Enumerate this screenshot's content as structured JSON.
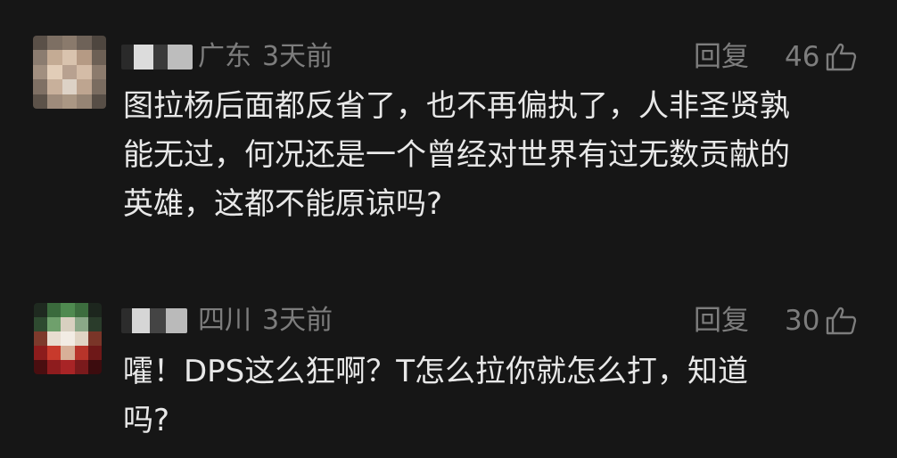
{
  "comments": [
    {
      "region": "广东",
      "time": "3天前",
      "reply_label": "回复",
      "likes": "46",
      "like_icon": "thumbs-up-icon",
      "body_lines": [
        "图拉杨后面都反省了，也不再偏执了，人非圣贤孰",
        "能无过，何况还是一个曾经对世界有过无数贡献的",
        "英雄，这都不能原谅吗?"
      ]
    },
    {
      "region": "四川",
      "time": "3天前",
      "reply_label": "回复",
      "likes": "30",
      "like_icon": "thumbs-up-icon",
      "body_lines": [
        "嚯！DPS这么狂啊？T怎么拉你就怎么打，知道",
        "吗?"
      ]
    }
  ],
  "colors": {
    "background": "#161616",
    "meta_text": "#7d7d7d",
    "body_text": "#e8e8e8"
  }
}
